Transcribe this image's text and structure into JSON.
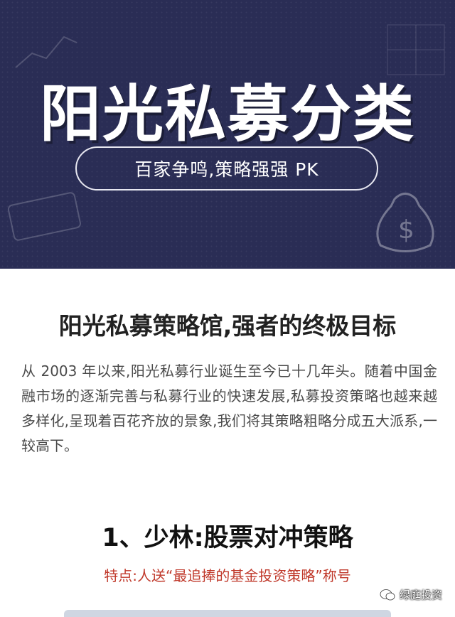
{
  "banner": {
    "title": "阳光私募分类",
    "subtitle": "百家争鸣,策略强强 PK",
    "background_color": "#2a2d55"
  },
  "content": {
    "heading": "阳光私募策略馆,强者的终极目标",
    "intro": "从 2003 年以来,阳光私募行业诞生至今已十几年头。随着中国金融市场的逐渐完善与私募行业的快速发展,私募投资策略也越来越多样化,呈现着百花齐放的景象,我们将其策略粗略分成五大派系,一较高下。",
    "section_title": "1、少林:股票对冲策略",
    "feature_text": "特点:人送“最追捧的基金投资策略”称号",
    "feature_color": "#c0392b"
  },
  "watermark": {
    "label": "绿庭投资",
    "icon": "wechat-icon"
  }
}
